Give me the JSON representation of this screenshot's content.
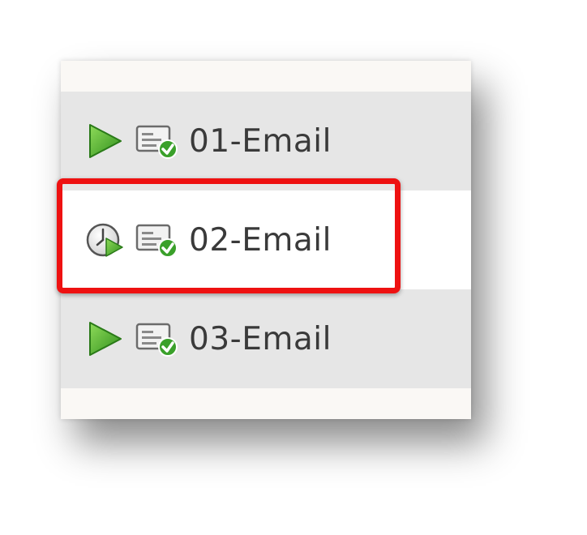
{
  "list": {
    "items": [
      {
        "label": "01-Email",
        "status_icon": "play-icon",
        "type_icon": "email-approved-icon"
      },
      {
        "label": "02-Email",
        "status_icon": "scheduled-clock-play-icon",
        "type_icon": "email-approved-icon"
      },
      {
        "label": "03-Email",
        "status_icon": "play-icon",
        "type_icon": "email-approved-icon"
      }
    ],
    "highlighted_item": "02-Email"
  },
  "colors": {
    "highlight_border": "#ee1111",
    "play_green": "#4caf2a",
    "row_alt_bg": "#e6e6e6",
    "text": "#3a3a3a"
  }
}
